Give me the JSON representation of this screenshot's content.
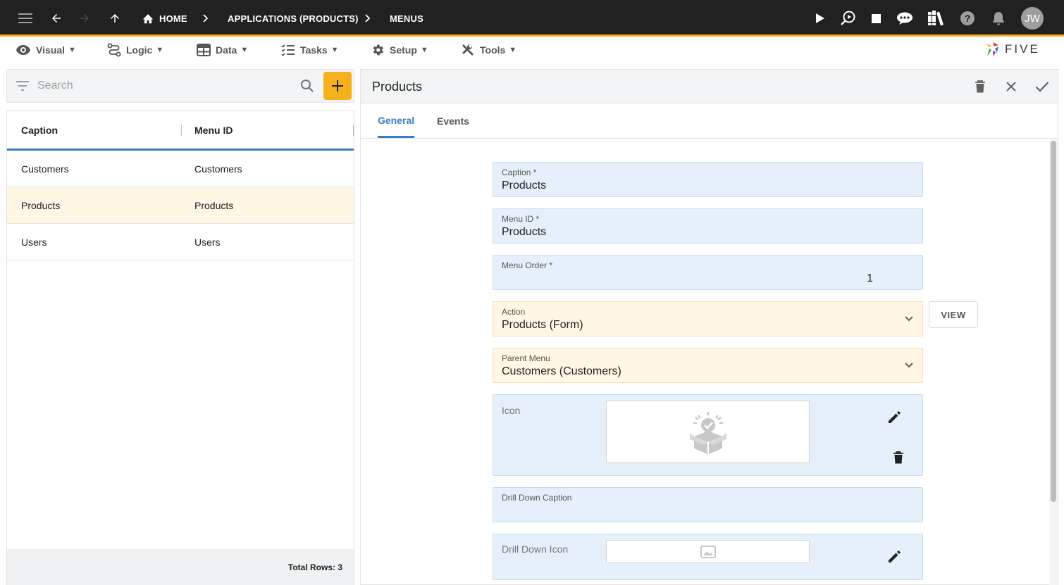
{
  "topbar": {
    "breadcrumbs": [
      "HOME",
      "APPLICATIONS (PRODUCTS)",
      "MENUS"
    ],
    "user_initials": "JW"
  },
  "menubar": {
    "items": [
      {
        "label": "Visual",
        "icon": "eye-icon"
      },
      {
        "label": "Logic",
        "icon": "logic-icon"
      },
      {
        "label": "Data",
        "icon": "table-icon"
      },
      {
        "label": "Tasks",
        "icon": "tasks-icon"
      },
      {
        "label": "Setup",
        "icon": "gear-icon"
      },
      {
        "label": "Tools",
        "icon": "tools-icon"
      }
    ],
    "logo_text": "FIVE"
  },
  "list": {
    "search_placeholder": "Search",
    "columns": [
      "Caption",
      "Menu ID"
    ],
    "rows": [
      {
        "caption": "Customers",
        "menu_id": "Customers"
      },
      {
        "caption": "Products",
        "menu_id": "Products"
      },
      {
        "caption": "Users",
        "menu_id": "Users"
      }
    ],
    "selected_index": 1,
    "total_rows": "Total Rows: 3"
  },
  "form": {
    "title": "Products",
    "tabs": [
      "General",
      "Events"
    ],
    "active_tab": 0,
    "fields": {
      "caption": {
        "label": "Caption *",
        "value": "Products"
      },
      "menu_id": {
        "label": "Menu ID *",
        "value": "Products"
      },
      "menu_order": {
        "label": "Menu Order *",
        "value": "1"
      },
      "action": {
        "label": "Action",
        "value": "Products (Form)"
      },
      "parent_menu": {
        "label": "Parent Menu",
        "value": "Customers (Customers)"
      },
      "icon": {
        "label": "Icon"
      },
      "drill_down_caption": {
        "label": "Drill Down Caption",
        "value": ""
      },
      "drill_down_icon": {
        "label": "Drill Down Icon"
      }
    },
    "view_label": "VIEW"
  },
  "colors": {
    "topbar_bg": "#212121",
    "accent": "#f5b01e",
    "primary": "#3b7dc4",
    "field_blue": "#e6f0fa",
    "field_yellow": "#fff6e3"
  }
}
